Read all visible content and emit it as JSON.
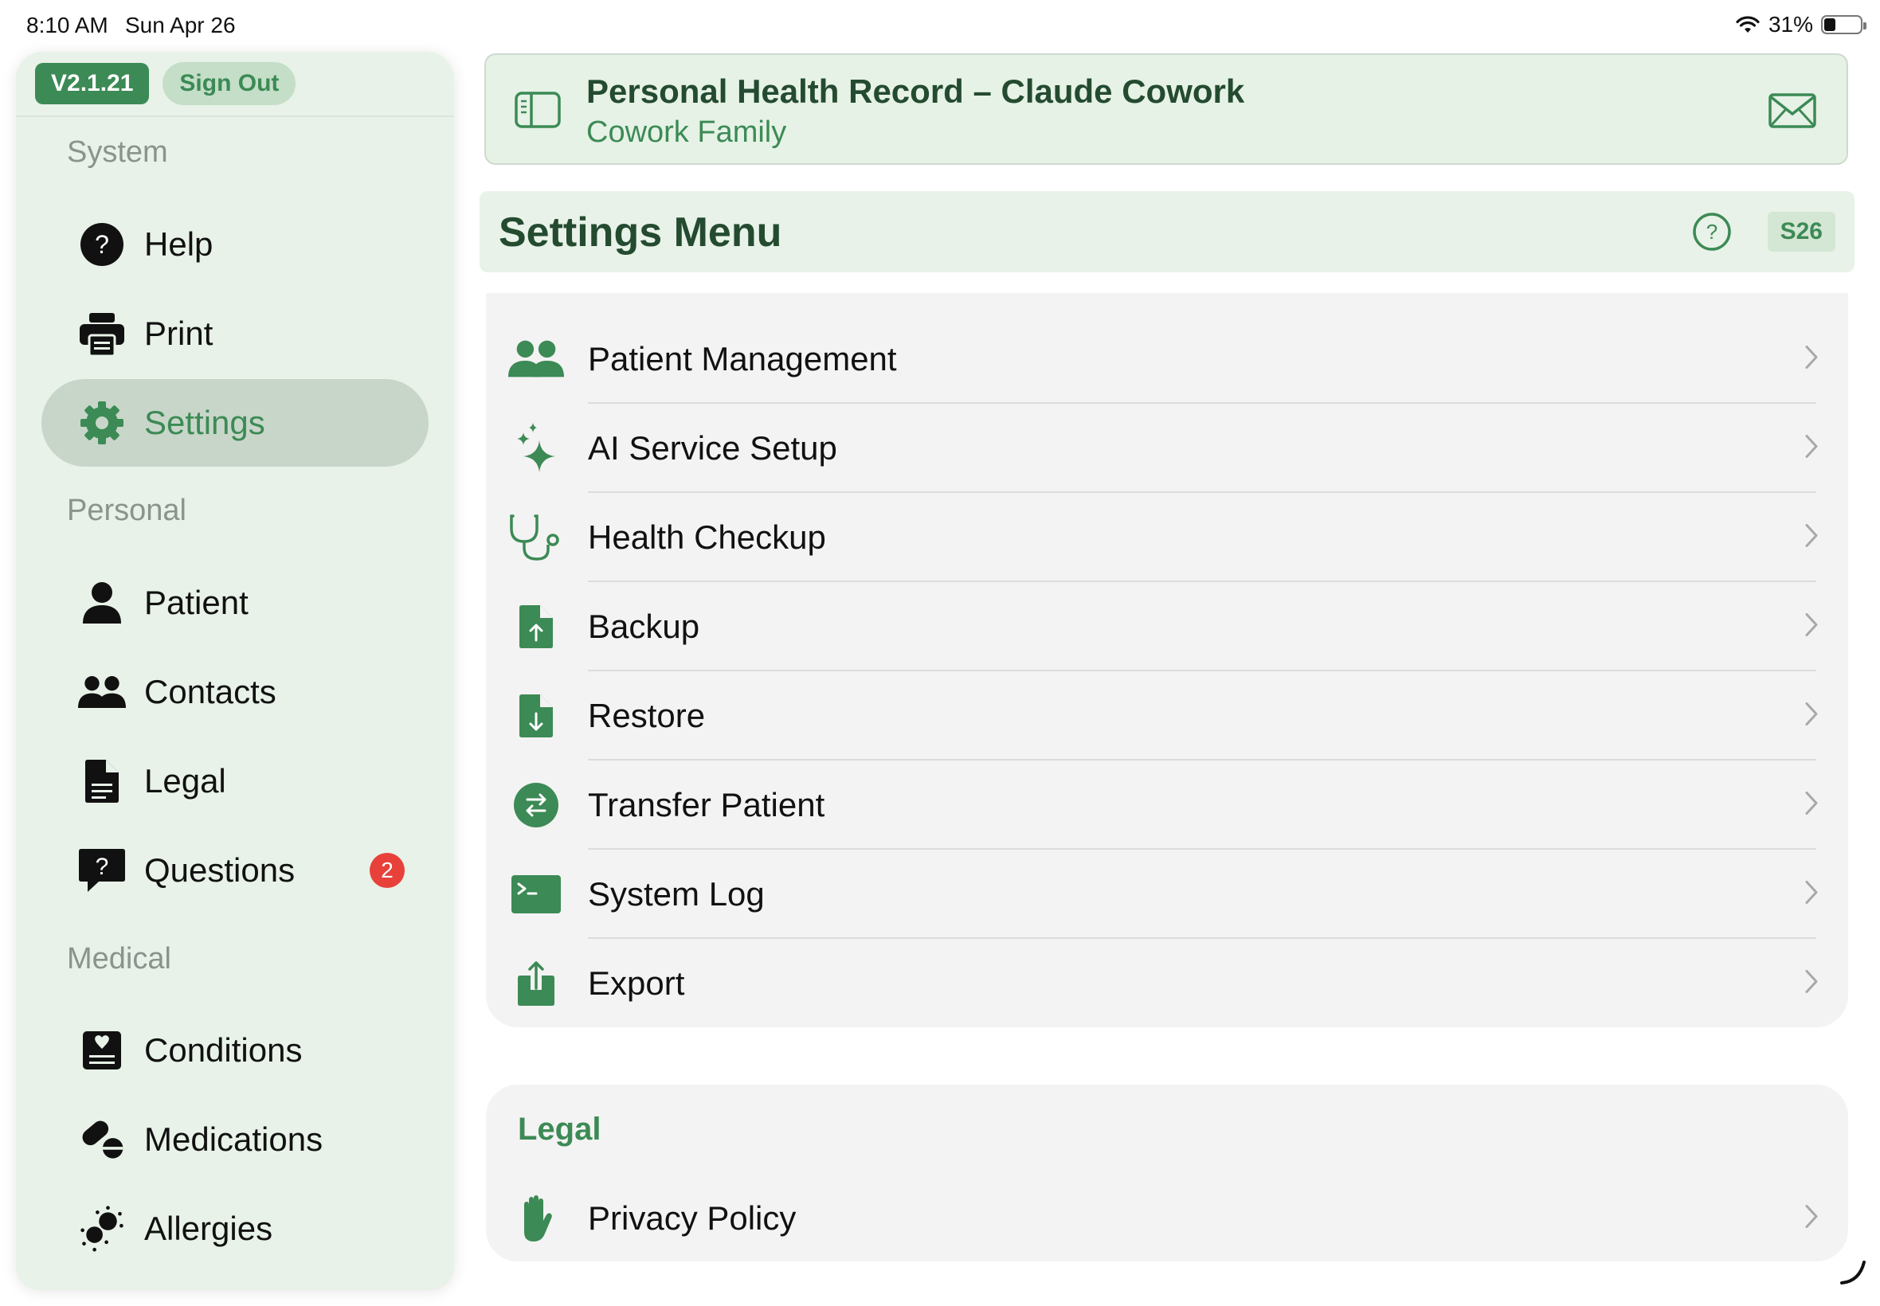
{
  "status_bar": {
    "time": "8:10 AM",
    "date": "Sun Apr 26",
    "battery": "31%"
  },
  "sidebar": {
    "version": "V2.1.21",
    "sign_out": "Sign Out",
    "sections": {
      "system": "System",
      "personal": "Personal",
      "medical": "Medical"
    },
    "items": [
      {
        "label": "Help",
        "icon": "question-circle-icon"
      },
      {
        "label": "Print",
        "icon": "printer-icon"
      },
      {
        "label": "Settings",
        "icon": "gear-icon",
        "active": true
      },
      {
        "label": "Patient",
        "icon": "person-icon"
      },
      {
        "label": "Contacts",
        "icon": "people-icon"
      },
      {
        "label": "Legal",
        "icon": "document-icon"
      },
      {
        "label": "Questions",
        "icon": "question-bubble-icon",
        "badge": "2"
      },
      {
        "label": "Conditions",
        "icon": "heart-chart-icon"
      },
      {
        "label": "Medications",
        "icon": "pills-icon"
      },
      {
        "label": "Allergies",
        "icon": "allergen-icon"
      }
    ]
  },
  "header": {
    "title": "Personal Health Record – Claude Cowork",
    "subtitle": "Cowork Family"
  },
  "settings": {
    "title": "Settings Menu",
    "screen_code": "S26",
    "items": [
      {
        "label": "Patient Management",
        "icon": "people-icon"
      },
      {
        "label": "AI Service Setup",
        "icon": "sparkles-icon"
      },
      {
        "label": "Health Checkup",
        "icon": "stethoscope-icon"
      },
      {
        "label": "Backup",
        "icon": "document-upload-icon"
      },
      {
        "label": "Restore",
        "icon": "document-download-icon"
      },
      {
        "label": "Transfer Patient",
        "icon": "transfer-icon"
      },
      {
        "label": "System Log",
        "icon": "terminal-icon"
      },
      {
        "label": "Export",
        "icon": "share-icon"
      }
    ]
  },
  "legal": {
    "header": "Legal",
    "items": [
      {
        "label": "Privacy Policy",
        "icon": "hand-icon"
      }
    ]
  },
  "colors": {
    "accent": "#3c8a55",
    "sidebar_bg": "#e8f2e8",
    "badge": "#e8413a"
  }
}
